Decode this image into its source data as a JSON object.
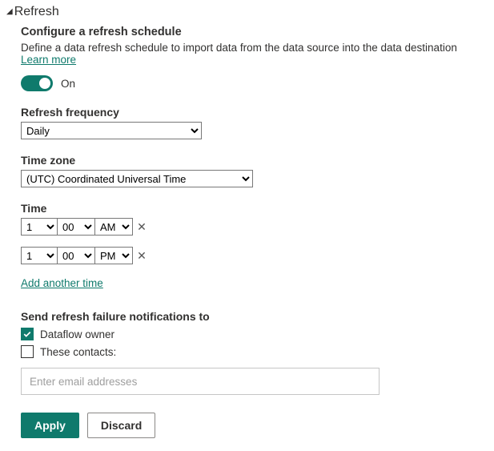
{
  "header": {
    "title": "Refresh"
  },
  "schedule": {
    "subtitle": "Configure a refresh schedule",
    "description": "Define a data refresh schedule to import data from the data source into the data destination ",
    "learn_more": "Learn more"
  },
  "toggle": {
    "label": "On"
  },
  "frequency": {
    "label": "Refresh frequency",
    "value": "Daily"
  },
  "timezone": {
    "label": "Time zone",
    "value": "(UTC) Coordinated Universal Time"
  },
  "time": {
    "label": "Time",
    "rows": [
      {
        "hour": "1",
        "minute": "00",
        "ampm": "AM"
      },
      {
        "hour": "1",
        "minute": "00",
        "ampm": "PM"
      }
    ],
    "add_label": "Add another time"
  },
  "notifications": {
    "label": "Send refresh failure notifications to",
    "owner_label": "Dataflow owner",
    "contacts_label": "These contacts:",
    "email_placeholder": "Enter email addresses"
  },
  "buttons": {
    "apply": "Apply",
    "discard": "Discard"
  }
}
